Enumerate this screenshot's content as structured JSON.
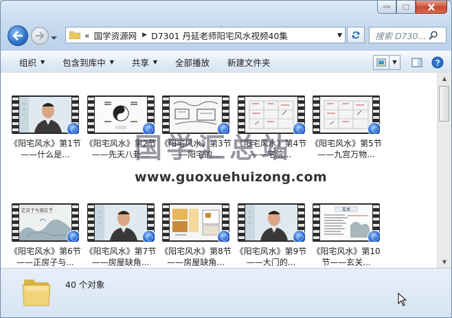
{
  "window": {
    "buttons": {
      "minimize": "minimize",
      "maximize": "maximize",
      "close": "close"
    }
  },
  "address": {
    "overflow": "«",
    "crumbs": [
      "国学资源网",
      "D7301 丹延老师阳宅风水视频40集"
    ],
    "search_placeholder": "搜索 D730..."
  },
  "toolbar": {
    "organize": "组织",
    "include_library": "包含到库中",
    "share": "共享",
    "play_all": "全部播放",
    "new_folder": "新建文件夹"
  },
  "files": [
    {
      "name": "《阳宅风水》第1节——什么是...",
      "thumb": "man"
    },
    {
      "name": "《阳宅风水》第2节——先天八卦...",
      "thumb": "diagram"
    },
    {
      "name": "《阳宅风水》第3节——阳宅的...",
      "thumb": "sketch"
    },
    {
      "name": "《阳宅风水》第4节——宅院...",
      "thumb": "grid"
    },
    {
      "name": "《阳宅风水》第5节——九宫万物...",
      "thumb": "grid"
    },
    {
      "name": "《阳宅风水》第6节——正房子与...",
      "thumb": "landscape"
    },
    {
      "name": "《阳宅风水》第7节——房屋缺角...",
      "thumb": "man"
    },
    {
      "name": "《阳宅风水》第8节——房屋缺角...",
      "thumb": "floorplan"
    },
    {
      "name": "《阳宅风水》第9节——大门的...",
      "thumb": "man"
    },
    {
      "name": "《阳宅风水》第10节——玄关...",
      "thumb": "text"
    }
  ],
  "thumb_texts": {
    "landscape": "正房子与偏房子",
    "text_title": "玄关"
  },
  "watermark": {
    "title": "国学汇总站",
    "url": "www.guoxuehuizong.com"
  },
  "status": {
    "count": "40 个对象"
  },
  "colors": {
    "accent": "#2e6fc4",
    "close": "#c74b33"
  }
}
